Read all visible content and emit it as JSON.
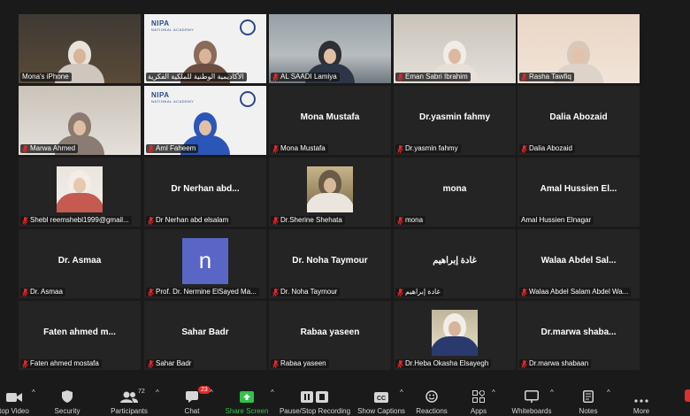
{
  "colors": {
    "active_speaker": "#d6e04a",
    "mic_muted": "#e02929",
    "share_green": "#33c24a",
    "avatar_purple": "#5966c6"
  },
  "tiles": [
    {
      "name": "Mona's iPhone",
      "label": "Mona's iPhone",
      "muted": false,
      "kind": "video",
      "active": true
    },
    {
      "name": "nipa-academy",
      "label": "الأكاديمية الوطنية للملكية الفكرية",
      "muted": false,
      "kind": "nipa-woman"
    },
    {
      "name": "AL SAADI Lamiya",
      "label": "AL SAADI Lamiya",
      "muted": true,
      "kind": "video"
    },
    {
      "name": "Eman Sabri Ibrahim",
      "label": "Eman Sabri Ibrahim",
      "muted": true,
      "kind": "video"
    },
    {
      "name": "Rasha Tawfiq",
      "label": "Rasha Tawfiq",
      "muted": true,
      "kind": "video"
    },
    {
      "name": "Marwa Ahmed",
      "label": "Marwa Ahmed",
      "muted": true,
      "kind": "video"
    },
    {
      "name": "Aml Faheem",
      "label": "Aml Faheem",
      "muted": true,
      "kind": "nipa-woman2"
    },
    {
      "name": "Mona Mustafa",
      "big": "Mona Mustafa",
      "label": "Mona Mustafa",
      "muted": true,
      "kind": "name"
    },
    {
      "name": "Dr.yasmin fahmy",
      "big": "Dr.yasmin fahmy",
      "label": "Dr.yasmin fahmy",
      "muted": true,
      "kind": "name"
    },
    {
      "name": "Dalia Abozaid",
      "big": "Dalia Abozaid",
      "label": "Dalia Abozaid",
      "muted": true,
      "kind": "name"
    },
    {
      "name": "Shebl",
      "label": "Shebl reemshebl1999@gmail...",
      "muted": true,
      "kind": "photo"
    },
    {
      "name": "Dr Nerhan abd elsalam",
      "big": "Dr Nerhan abd...",
      "label": "Dr Nerhan abd elsalam",
      "muted": true,
      "kind": "name"
    },
    {
      "name": "Dr.Sherine Shehata",
      "label": "Dr.Sherine Shehata",
      "muted": true,
      "kind": "photo2"
    },
    {
      "name": "mona",
      "big": "mona",
      "label": "mona",
      "muted": true,
      "kind": "name"
    },
    {
      "name": "Amal Hussien Elnagar",
      "big": "Amal Hussien El...",
      "label": "Amal Hussien Elnagar",
      "muted": false,
      "kind": "name"
    },
    {
      "name": "Dr. Asmaa",
      "big": "Dr. Asmaa",
      "label": "Dr. Asmaa",
      "muted": true,
      "kind": "name"
    },
    {
      "name": "Prof. Dr. Nermine ElSayed",
      "label": "Prof. Dr. Nermine ElSayed Ma...",
      "muted": true,
      "kind": "avatar",
      "avatar": "n"
    },
    {
      "name": "Dr. Noha Taymour",
      "big": "Dr. Noha Taymour",
      "label": "Dr. Noha Taymour",
      "muted": true,
      "kind": "name"
    },
    {
      "name": "غادة إبراهيم",
      "big": "غادة إبراهيم",
      "label": "غادة إبراهيم",
      "muted": true,
      "kind": "name"
    },
    {
      "name": "Walaa Abdel Salam Abdel Wa",
      "big": "Walaa Abdel Sal...",
      "label": "Walaa Abdel Salam Abdel Wa...",
      "muted": true,
      "kind": "name"
    },
    {
      "name": "Faten ahmed mostafa",
      "big": "Faten ahmed m...",
      "label": "Faten ahmed mostafa",
      "muted": true,
      "kind": "name"
    },
    {
      "name": "Sahar Badr",
      "big": "Sahar Badr",
      "label": "Sahar Badr",
      "muted": true,
      "kind": "name"
    },
    {
      "name": "Rabaa yaseen",
      "big": "Rabaa yaseen",
      "label": "Rabaa yaseen",
      "muted": true,
      "kind": "name"
    },
    {
      "name": "Dr.Heba Okasha Elsayegh",
      "label": "Dr.Heba Okasha Elsayegh",
      "muted": true,
      "kind": "photo3"
    },
    {
      "name": "Dr.marwa shabaan",
      "big": "Dr.marwa shaba...",
      "label": "Dr.marwa shabaan",
      "muted": true,
      "kind": "name"
    }
  ],
  "nipa_logo": "NIPA",
  "toolbar": {
    "stop_video": "top Video",
    "security": "Security",
    "participants": "Participants",
    "participants_count": "72",
    "chat": "Chat",
    "chat_badge": "23",
    "share_screen": "Share Screen",
    "record": "Pause/Stop Recording",
    "captions": "Show Captions",
    "reactions": "Reactions",
    "apps": "Apps",
    "whiteboards": "Whiteboards",
    "notes": "Notes",
    "more": "More"
  }
}
